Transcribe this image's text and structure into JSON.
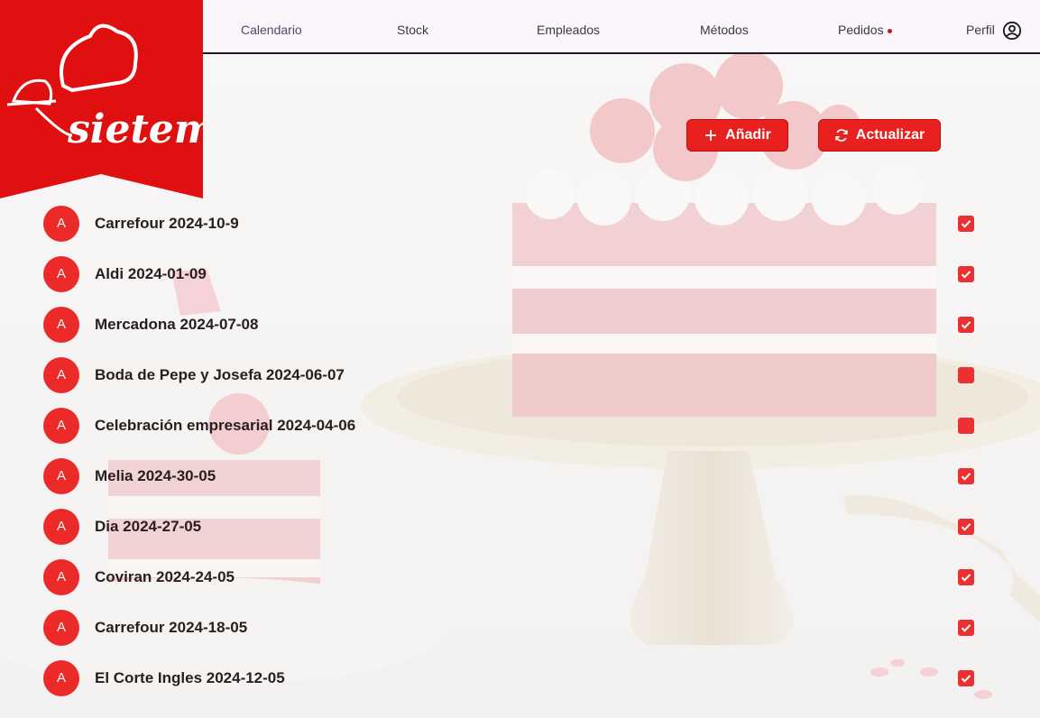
{
  "nav": {
    "items": [
      {
        "label": "Calendario",
        "active": true
      },
      {
        "label": "Stock"
      },
      {
        "label": "Empleados"
      },
      {
        "label": "Métodos"
      },
      {
        "label": "Pedidos",
        "has_notification": true
      },
      {
        "label": "Perfil",
        "icon": "user-circle-icon"
      }
    ]
  },
  "brand": {
    "name": "sietem",
    "color": "#e01010"
  },
  "actions": {
    "add_label": "Añadir",
    "add_icon": "plus-icon",
    "refresh_label": "Actualizar",
    "refresh_icon": "refresh-icon"
  },
  "orders": [
    {
      "avatar": "A",
      "label": "Carrefour 2024-10-9",
      "checked": true
    },
    {
      "avatar": "A",
      "label": "Aldi 2024-01-09",
      "checked": true
    },
    {
      "avatar": "A",
      "label": "Mercadona 2024-07-08",
      "checked": true
    },
    {
      "avatar": "A",
      "label": "Boda de Pepe y Josefa 2024-06-07",
      "checked": false
    },
    {
      "avatar": "A",
      "label": "Celebración empresarial 2024-04-06",
      "checked": false
    },
    {
      "avatar": "A",
      "label": "Melia 2024-30-05",
      "checked": true
    },
    {
      "avatar": "A",
      "label": "Dia 2024-27-05",
      "checked": true
    },
    {
      "avatar": "A",
      "label": "Coviran 2024-24-05",
      "checked": true
    },
    {
      "avatar": "A",
      "label": "Carrefour 2024-18-05",
      "checked": true
    },
    {
      "avatar": "A",
      "label": "El Corte Ingles 2024-12-05",
      "checked": true
    }
  ],
  "colors": {
    "accent": "#e9211e",
    "checkbox": "#ea3030",
    "avatar": "#ec2a2a"
  }
}
